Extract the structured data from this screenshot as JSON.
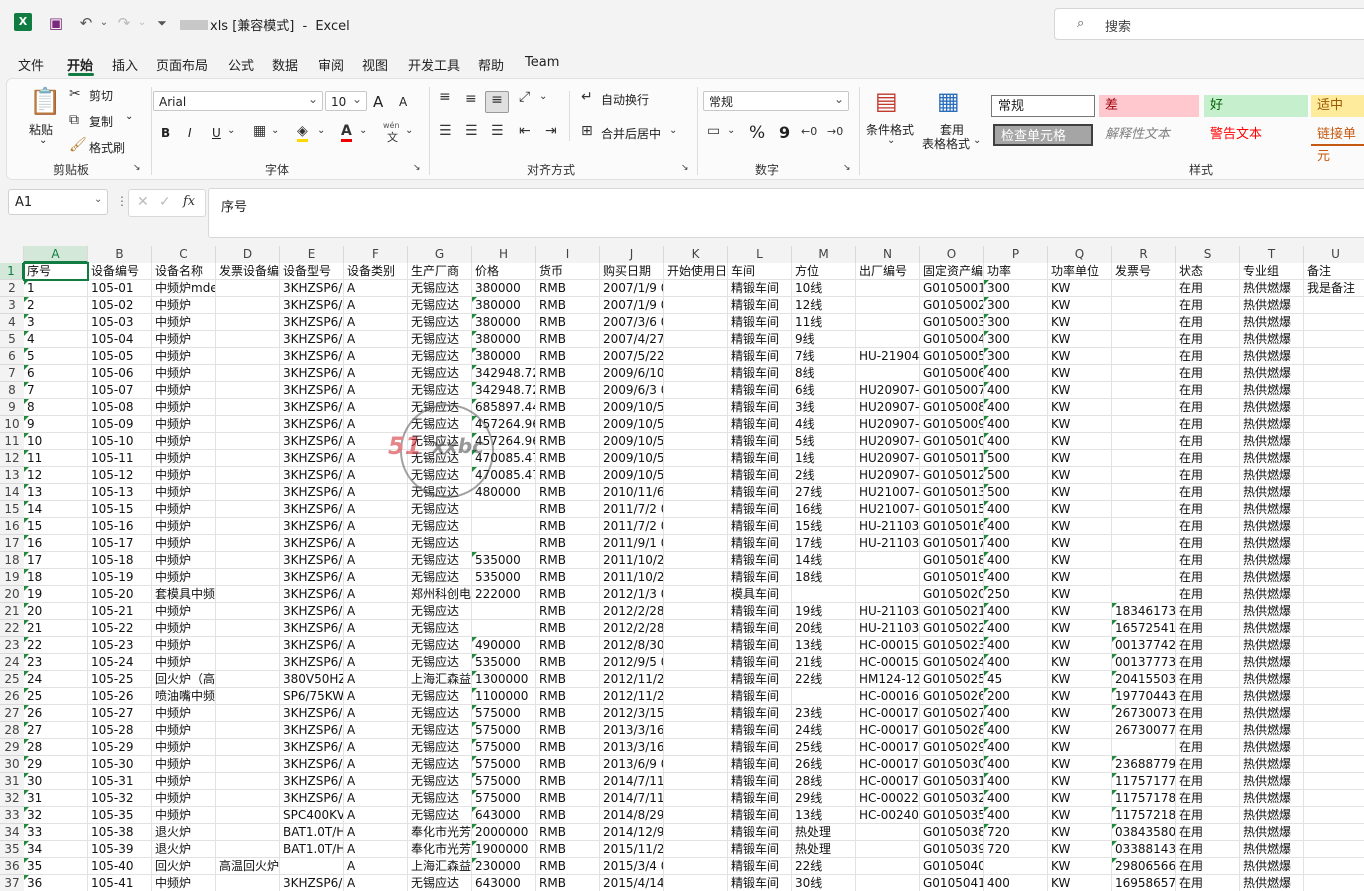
{
  "titlebar": {
    "filename": "xls [兼容模式]",
    "separator": "-",
    "app": "Excel",
    "search_placeholder": "搜索"
  },
  "menu": [
    "文件",
    "开始",
    "插入",
    "页面布局",
    "公式",
    "数据",
    "审阅",
    "视图",
    "开发工具",
    "帮助",
    "Team"
  ],
  "ribbon": {
    "clipboard": {
      "paste": "粘贴",
      "cut": "剪切",
      "copy": "复制",
      "format_painter": "格式刷",
      "label": "剪贴板"
    },
    "font": {
      "name": "Arial",
      "size": "10",
      "bold": "B",
      "italic": "I",
      "underline": "U",
      "label": "字体",
      "increase": "A",
      "decrease": "A",
      "phonetic": "wén"
    },
    "alignment": {
      "wrap": "自动换行",
      "merge": "合并后居中",
      "label": "对齐方式"
    },
    "number": {
      "format": "常规",
      "percent": "%",
      "comma": "9",
      "label": "数字"
    },
    "styles": {
      "conditional": "条件格式",
      "table_line1": "套用",
      "table_line2": "表格格式",
      "cells": [
        "常规",
        "差",
        "好",
        "适中",
        "检查单元格",
        "解释性文本",
        "警告文本",
        "链接单元"
      ],
      "label": "样式"
    }
  },
  "formula_bar": {
    "name_box": "A1",
    "fx": "fx",
    "content": "序号"
  },
  "grid": {
    "columns": [
      "A",
      "B",
      "C",
      "D",
      "E",
      "F",
      "G",
      "H",
      "I",
      "J",
      "K",
      "L",
      "M",
      "N",
      "O",
      "P",
      "Q",
      "R",
      "S",
      "T",
      "U"
    ],
    "header_row": [
      "序号",
      "设备编号",
      "设备名称",
      "发票设备编号",
      "设备型号",
      "设备类别",
      "生产厂商",
      "价格",
      "货币",
      "购买日期",
      "开始使用日期",
      "车间",
      "方位",
      "出厂编号",
      "固定资产编号",
      "功率",
      "功率单位",
      "发票号",
      "状态",
      "专业组",
      "备注"
    ],
    "rows": [
      [
        "1",
        "105-01",
        "中频炉mde",
        "",
        "3KHZSP6/",
        "A",
        "无锡应达",
        "380000",
        "RMB",
        "2007/1/9 0",
        "",
        "精锻车间",
        "10线",
        "",
        "G0105001",
        "300",
        "KW",
        "",
        "在用",
        "热供燃爆",
        "我是备注"
      ],
      [
        "2",
        "105-02",
        "中频炉",
        "",
        "3KHZSP6/",
        "A",
        "无锡应达",
        "380000",
        "RMB",
        "2007/1/9 0",
        "",
        "精锻车间",
        "12线",
        "",
        "G0105002",
        "300",
        "KW",
        "",
        "在用",
        "热供燃爆",
        ""
      ],
      [
        "3",
        "105-03",
        "中频炉",
        "",
        "3KHZSP6/",
        "A",
        "无锡应达",
        "380000",
        "RMB",
        "2007/3/6 0",
        "",
        "精锻车间",
        "11线",
        "",
        "G0105003",
        "300",
        "KW",
        "",
        "在用",
        "热供燃爆",
        ""
      ],
      [
        "4",
        "105-04",
        "中频炉",
        "",
        "3KHZSP6/",
        "A",
        "无锡应达",
        "380000",
        "RMB",
        "2007/4/27",
        "",
        "精锻车间",
        "9线",
        "",
        "G0105004",
        "300",
        "KW",
        "",
        "在用",
        "热供燃爆",
        ""
      ],
      [
        "5",
        "105-05",
        "中频炉",
        "",
        "3KHZSP6/",
        "A",
        "无锡应达",
        "380000",
        "RMB",
        "2007/5/22",
        "",
        "精锻车间",
        "7线",
        "HU-21904-",
        "G0105005",
        "300",
        "KW",
        "",
        "在用",
        "热供燃爆",
        ""
      ],
      [
        "6",
        "105-06",
        "中频炉",
        "",
        "3KHZSP6/",
        "A",
        "无锡应达",
        "342948.72",
        "RMB",
        "2009/6/10",
        "",
        "精锻车间",
        "8线",
        "",
        "G0105006",
        "400",
        "KW",
        "",
        "在用",
        "热供燃爆",
        ""
      ],
      [
        "7",
        "105-07",
        "中频炉",
        "",
        "3KHZSP6/",
        "A",
        "无锡应达",
        "342948.72",
        "RMB",
        "2009/6/3 0",
        "",
        "精锻车间",
        "6线",
        "HU20907-1",
        "G0105007",
        "400",
        "KW",
        "",
        "在用",
        "热供燃爆",
        ""
      ],
      [
        "8",
        "105-08",
        "中频炉",
        "",
        "3KHZSP6/",
        "A",
        "无锡应达",
        "685897.44",
        "RMB",
        "2009/10/5",
        "",
        "精锻车间",
        "3线",
        "HU20907-1",
        "G0105008",
        "400",
        "KW",
        "",
        "在用",
        "热供燃爆",
        ""
      ],
      [
        "9",
        "105-09",
        "中频炉",
        "",
        "3KHZSP6/",
        "A",
        "无锡应达",
        "457264.96",
        "RMB",
        "2009/10/5",
        "",
        "精锻车间",
        "4线",
        "HU20907-1",
        "G0105009",
        "400",
        "KW",
        "",
        "在用",
        "热供燃爆",
        ""
      ],
      [
        "10",
        "105-10",
        "中频炉",
        "",
        "3KHZSP6/",
        "A",
        "无锡应达",
        "457264.96",
        "RMB",
        "2009/10/5",
        "",
        "精锻车间",
        "5线",
        "HU20907-1",
        "G0105010",
        "400",
        "KW",
        "",
        "在用",
        "热供燃爆",
        ""
      ],
      [
        "11",
        "105-11",
        "中频炉",
        "",
        "3KHZSP6/",
        "A",
        "无锡应达",
        "470085.47",
        "RMB",
        "2009/10/5",
        "",
        "精锻车间",
        "1线",
        "HU20907-1",
        "G0105011",
        "500",
        "KW",
        "",
        "在用",
        "热供燃爆",
        ""
      ],
      [
        "12",
        "105-12",
        "中频炉",
        "",
        "3KHZSP6/",
        "A",
        "无锡应达",
        "470085.47",
        "RMB",
        "2009/10/5",
        "",
        "精锻车间",
        "2线",
        "HU20907-1",
        "G0105012",
        "500",
        "KW",
        "",
        "在用",
        "热供燃爆",
        ""
      ],
      [
        "13",
        "105-13",
        "中频炉",
        "",
        "3KHZSP6/",
        "A",
        "无锡应达",
        "480000",
        "RMB",
        "2010/11/6",
        "",
        "精锻车间",
        "27线",
        "HU21007-1",
        "G0105013",
        "500",
        "KW",
        "",
        "在用",
        "热供燃爆",
        ""
      ],
      [
        "14",
        "105-15",
        "中频炉",
        "",
        "3KHZSP6/",
        "A",
        "无锡应达",
        "",
        "RMB",
        "2011/7/2 0",
        "",
        "精锻车间",
        "16线",
        "HU21007-1",
        "G0105015",
        "400",
        "KW",
        "",
        "在用",
        "热供燃爆",
        ""
      ],
      [
        "15",
        "105-16",
        "中频炉",
        "",
        "3KHZSP6/",
        "A",
        "无锡应达",
        "",
        "RMB",
        "2011/7/2 0",
        "",
        "精锻车间",
        "15线",
        "HU-21103-",
        "G0105016",
        "400",
        "KW",
        "",
        "在用",
        "热供燃爆",
        ""
      ],
      [
        "16",
        "105-17",
        "中频炉",
        "",
        "3KHZSP6/",
        "A",
        "无锡应达",
        "",
        "RMB",
        "2011/9/1 0",
        "",
        "精锻车间",
        "17线",
        "HU-21103-",
        "G0105017",
        "400",
        "KW",
        "",
        "在用",
        "热供燃爆",
        ""
      ],
      [
        "17",
        "105-18",
        "中频炉",
        "",
        "3KHZSP6/",
        "A",
        "无锡应达",
        "535000",
        "RMB",
        "2011/10/26",
        "",
        "精锻车间",
        "14线",
        "",
        "G0105018",
        "400",
        "KW",
        "",
        "在用",
        "热供燃爆",
        ""
      ],
      [
        "18",
        "105-19",
        "中频炉",
        "",
        "3KHZSP6/",
        "A",
        "无锡应达",
        "535000",
        "RMB",
        "2011/10/26",
        "",
        "精锻车间",
        "18线",
        "",
        "G0105019",
        "400",
        "KW",
        "",
        "在用",
        "热供燃爆",
        ""
      ],
      [
        "19",
        "105-20",
        "套模具中频",
        "",
        "3KHZSP6/",
        "A",
        "郑州科创电",
        "222000",
        "RMB",
        "2012/1/3 0",
        "",
        "模具车间",
        "",
        "",
        "G0105020",
        "250",
        "KW",
        "",
        "在用",
        "热供燃爆",
        ""
      ],
      [
        "20",
        "105-21",
        "中频炉",
        "",
        "3KHZSP6/",
        "A",
        "无锡应达",
        "",
        "RMB",
        "2012/2/28",
        "",
        "精锻车间",
        "19线",
        "HU-21103-",
        "G0105021",
        "400",
        "KW",
        "18346173",
        "在用",
        "热供燃爆",
        ""
      ],
      [
        "21",
        "105-22",
        "中频炉",
        "",
        "3KHZSP6/",
        "A",
        "无锡应达",
        "",
        "RMB",
        "2012/2/28",
        "",
        "精锻车间",
        "20线",
        "HU-21103-",
        "G0105022",
        "400",
        "KW",
        "16572541",
        "在用",
        "热供燃爆",
        ""
      ],
      [
        "22",
        "105-23",
        "中频炉",
        "",
        "3KHZSP6/",
        "A",
        "无锡应达",
        "490000",
        "RMB",
        "2012/8/30",
        "",
        "精锻车间",
        "13线",
        "HC-000157",
        "G0105023",
        "400",
        "KW",
        "00137742",
        "在用",
        "热供燃爆",
        ""
      ],
      [
        "23",
        "105-24",
        "中频炉",
        "",
        "3KHZSP6/",
        "A",
        "无锡应达",
        "535000",
        "RMB",
        "2012/9/5 0",
        "",
        "精锻车间",
        "21线",
        "HC-000154",
        "G0105024",
        "400",
        "KW",
        "00137773",
        "在用",
        "热供燃爆",
        ""
      ],
      [
        "24",
        "105-25",
        "回火炉（高",
        "",
        "380V50HZ",
        "A",
        "上海汇森益",
        "1300000",
        "RMB",
        "2012/11/26",
        "",
        "精锻车间",
        "22线",
        "HM124-12",
        "G0105025",
        "45",
        "KW",
        "20415503",
        "在用",
        "热供燃爆",
        ""
      ],
      [
        "25",
        "105-26",
        "喷油嘴中频",
        "",
        "SP6/75KW",
        "A",
        "无锡应达",
        "1100000",
        "RMB",
        "2012/11/26",
        "",
        "精锻车间",
        "",
        "HC-000162",
        "G0105026",
        "200",
        "KW",
        "19770443",
        "在用",
        "热供燃爆",
        ""
      ],
      [
        "26",
        "105-27",
        "中频炉",
        "",
        "3KHZSP6/",
        "A",
        "无锡应达",
        "575000",
        "RMB",
        "2012/3/15",
        "",
        "精锻车间",
        "23线",
        "HC-000171",
        "G0105027",
        "400",
        "KW",
        "26730073",
        "在用",
        "热供燃爆",
        ""
      ],
      [
        "27",
        "105-28",
        "中频炉",
        "",
        "3KHZSP6/",
        "A",
        "无锡应达",
        "575000",
        "RMB",
        "2013/3/16",
        "",
        "精锻车间",
        "24线",
        "HC-000172",
        "G0105028",
        "400",
        "KW",
        "26730077",
        "在用",
        "热供燃爆",
        ""
      ],
      [
        "28",
        "105-29",
        "中频炉",
        "",
        "3KHZSP6/",
        "A",
        "无锡应达",
        "575000",
        "RMB",
        "2013/3/16",
        "",
        "精锻车间",
        "25线",
        "HC-000173",
        "G0105029",
        "400",
        "KW",
        "",
        "在用",
        "热供燃爆",
        ""
      ],
      [
        "29",
        "105-30",
        "中频炉",
        "",
        "3KHZSP6/",
        "A",
        "无锡应达",
        "575000",
        "RMB",
        "2013/6/9 0",
        "",
        "精锻车间",
        "26线",
        "HC-000174",
        "G0105030",
        "400",
        "KW",
        "23688779",
        "在用",
        "热供燃爆",
        ""
      ],
      [
        "30",
        "105-31",
        "中频炉",
        "",
        "3KHZSP6/",
        "A",
        "无锡应达",
        "575000",
        "RMB",
        "2014/7/11",
        "",
        "精锻车间",
        "28线",
        "HC-000175",
        "G0105031",
        "400",
        "KW",
        "11757177",
        "在用",
        "热供燃爆",
        ""
      ],
      [
        "31",
        "105-32",
        "中频炉",
        "",
        "3KHZSP6/",
        "A",
        "无锡应达",
        "575000",
        "RMB",
        "2014/7/11",
        "",
        "精锻车间",
        "29线",
        "HC-000229",
        "G0105032",
        "400",
        "KW",
        "11757178",
        "在用",
        "热供燃爆",
        ""
      ],
      [
        "32",
        "105-35",
        "中频炉",
        "",
        "SPC400KV",
        "A",
        "无锡应达",
        "643000",
        "RMB",
        "2014/8/29",
        "",
        "精锻车间",
        "13线",
        "HC-00240-",
        "G0105035",
        "400",
        "KW",
        "11757218",
        "在用",
        "热供燃爆",
        ""
      ],
      [
        "33",
        "105-38",
        "退火炉",
        "",
        "BAT1.0T/H",
        "A",
        "奉化市光芳",
        "2000000",
        "RMB",
        "2014/12/9",
        "",
        "精锻车间",
        "热处理",
        "",
        "G0105038",
        "720",
        "KW",
        "03843580/",
        "在用",
        "热供燃爆",
        ""
      ],
      [
        "34",
        "105-39",
        "退火炉",
        "",
        "BAT1.0T/H",
        "A",
        "奉化市光芳",
        "1900000",
        "RMB",
        "2015/11/24",
        "",
        "精锻车间",
        "热处理",
        "",
        "G0105039",
        "720",
        "KW",
        "03388143/",
        "在用",
        "热供燃爆",
        ""
      ],
      [
        "35",
        "105-40",
        "回火炉",
        "高温回火炉",
        "",
        "A",
        "上海汇森益",
        "230000",
        "RMB",
        "2015/3/4 0",
        "",
        "精锻车间",
        "22线",
        "",
        "G0105040",
        "",
        "KW",
        "29806566/",
        "在用",
        "热供燃爆",
        ""
      ],
      [
        "36",
        "105-41",
        "中频炉",
        "",
        "3KHZSP6/",
        "A",
        "无锡应达",
        "643000",
        "RMB",
        "2015/4/14",
        "",
        "精锻车间",
        "30线",
        "",
        "G0105041",
        "400",
        "KW",
        "16958657",
        "在用",
        "热供燃爆",
        ""
      ]
    ]
  },
  "watermark_text": {
    "part1": "51",
    "part2": "xxbc"
  },
  "colors": {
    "accent": "#107c41",
    "bad_bg": "#ffc7ce",
    "good_bg": "#c6efce",
    "neutral_bg": "#ffeb9c"
  }
}
